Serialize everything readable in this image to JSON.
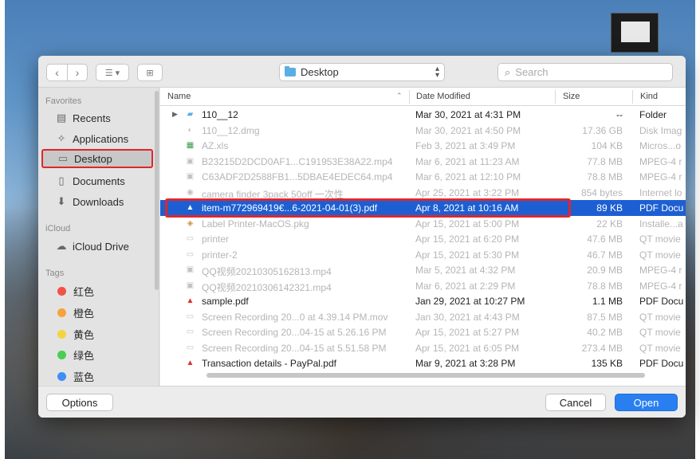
{
  "toolbar": {
    "location": "Desktop",
    "search_placeholder": "Search"
  },
  "sidebar": {
    "favorites_heading": "Favorites",
    "favorites": [
      {
        "label": "Recents",
        "icon": "recents-icon"
      },
      {
        "label": "Applications",
        "icon": "applications-icon"
      },
      {
        "label": "Desktop",
        "icon": "desktop-icon",
        "selected": true
      },
      {
        "label": "Documents",
        "icon": "documents-icon"
      },
      {
        "label": "Downloads",
        "icon": "downloads-icon"
      }
    ],
    "icloud_heading": "iCloud",
    "icloud": [
      {
        "label": "iCloud Drive",
        "icon": "cloud-icon"
      }
    ],
    "tags_heading": "Tags",
    "tags": [
      {
        "label": "红色",
        "color": "#f2504b"
      },
      {
        "label": "橙色",
        "color": "#f6a33b"
      },
      {
        "label": "黄色",
        "color": "#f5d33f"
      },
      {
        "label": "绿色",
        "color": "#4ccd55"
      },
      {
        "label": "蓝色",
        "color": "#3d8ef5"
      }
    ]
  },
  "columns": {
    "name": "Name",
    "date": "Date Modified",
    "size": "Size",
    "kind": "Kind"
  },
  "files": [
    {
      "name": "110__12",
      "date": "Mar 30, 2021 at 4:31 PM",
      "size": "--",
      "kind": "Folder",
      "icon": "folder-icon",
      "state": "normal"
    },
    {
      "name": "110__12.dmg",
      "date": "Mar 30, 2021 at 4:50 PM",
      "size": "17.36 GB",
      "kind": "Disk Imag",
      "icon": "disk-image-icon",
      "state": "dim"
    },
    {
      "name": "AZ.xls",
      "date": "Feb 3, 2021 at 3:49 PM",
      "size": "104 KB",
      "kind": "Micros...o",
      "icon": "spreadsheet-icon",
      "state": "dim"
    },
    {
      "name": "B23215D2DCD0AF1...C191953E38A22.mp4",
      "date": "Mar 6, 2021 at 11:23 AM",
      "size": "77.8 MB",
      "kind": "MPEG-4 r",
      "icon": "video-icon",
      "state": "dim"
    },
    {
      "name": "C63ADF2D2588FB1...5DBAE4EDEC64.mp4",
      "date": "Mar 6, 2021 at 12:10 PM",
      "size": "78.8 MB",
      "kind": "MPEG-4 r",
      "icon": "video-icon",
      "state": "dim"
    },
    {
      "name": "camera finder 3pack 50off 一次性",
      "date": "Apr 25, 2021 at 3:22 PM",
      "size": "854 bytes",
      "kind": "Internet lo",
      "icon": "link-icon",
      "state": "dim"
    },
    {
      "name": "item-m772969419€...6-2021-04-01(3).pdf",
      "date": "Apr 8, 2021 at 10:16 AM",
      "size": "89 KB",
      "kind": "PDF Docu",
      "icon": "pdf-icon",
      "state": "highlight"
    },
    {
      "name": "Label Printer-MacOS.pkg",
      "date": "Apr 15, 2021 at 5:00 PM",
      "size": "22 KB",
      "kind": "Installe...a",
      "icon": "package-icon",
      "state": "dim"
    },
    {
      "name": "printer",
      "date": "Apr 15, 2021 at 6:20 PM",
      "size": "47.6 MB",
      "kind": "QT movie",
      "icon": "movie-icon",
      "state": "dim"
    },
    {
      "name": "printer-2",
      "date": "Apr 15, 2021 at 5:30 PM",
      "size": "46.7 MB",
      "kind": "QT movie",
      "icon": "movie-icon",
      "state": "dim"
    },
    {
      "name": "QQ视频20210305162813.mp4",
      "date": "Mar 5, 2021 at 4:32 PM",
      "size": "20.9 MB",
      "kind": "MPEG-4 r",
      "icon": "video-icon",
      "state": "dim"
    },
    {
      "name": "QQ视频20210306142321.mp4",
      "date": "Mar 6, 2021 at 2:29 PM",
      "size": "78.8 MB",
      "kind": "MPEG-4 r",
      "icon": "video-icon",
      "state": "dim"
    },
    {
      "name": "sample.pdf",
      "date": "Jan 29, 2021 at 10:27 PM",
      "size": "1.1 MB",
      "kind": "PDF Docu",
      "icon": "pdf-icon",
      "state": "normal"
    },
    {
      "name": "Screen Recording 20...0 at 4.39.14 PM.mov",
      "date": "Jan 30, 2021 at 4:43 PM",
      "size": "87.5 MB",
      "kind": "QT movie",
      "icon": "movie-icon",
      "state": "dim"
    },
    {
      "name": "Screen Recording 20...04-15 at 5.26.16 PM",
      "date": "Apr 15, 2021 at 5:27 PM",
      "size": "40.2 MB",
      "kind": "QT movie",
      "icon": "movie-icon",
      "state": "dim"
    },
    {
      "name": "Screen Recording 20...04-15 at 5.51.58 PM",
      "date": "Apr 15, 2021 at 6:05 PM",
      "size": "273.4 MB",
      "kind": "QT movie",
      "icon": "movie-icon",
      "state": "dim"
    },
    {
      "name": "Transaction details - PayPal.pdf",
      "date": "Mar 9, 2021 at 3:28 PM",
      "size": "135 KB",
      "kind": "PDF Docu",
      "icon": "pdf-icon",
      "state": "normal"
    }
  ],
  "buttons": {
    "options": "Options",
    "cancel": "Cancel",
    "open": "Open"
  },
  "colors": {
    "accent": "#2a7ff0",
    "selection": "#1d5fd3",
    "annotation": "#e0262a"
  }
}
